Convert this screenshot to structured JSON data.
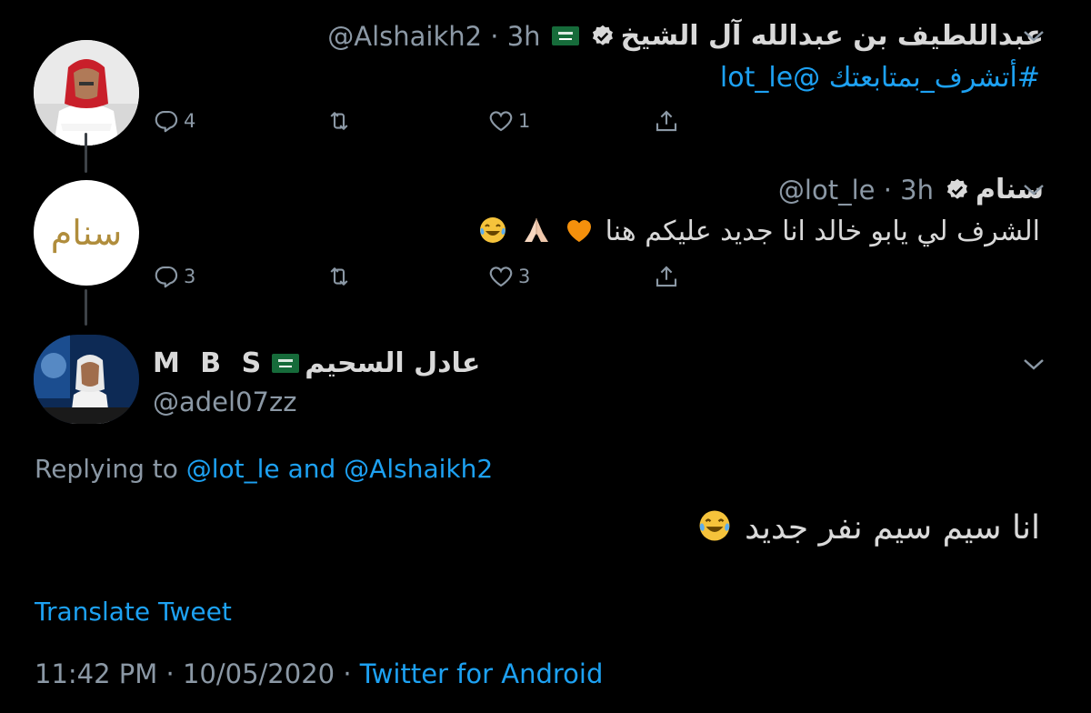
{
  "tweets": [
    {
      "name": "عبداللطيف بن عبدالله آل الشيخ",
      "handle": "@Alshaikh2",
      "time": "3h",
      "mention": "@lot_le",
      "hashtag": "#أتشرف_بمتابعتك",
      "replies": "4",
      "likes": "1"
    },
    {
      "name": "سنام",
      "avatar_text": "سنام",
      "handle": "@lot_le",
      "time": "3h",
      "text": "الشرف لي يابو خالد انا جديد عليكم هنا",
      "emojis": [
        "orange-heart",
        "folded-hands",
        "tears-of-joy"
      ],
      "replies": "3",
      "likes": "3"
    }
  ],
  "main_tweet": {
    "name": "عادل السحيم",
    "name_suffix": "M B S",
    "handle": "@adel07zz",
    "replying_prefix": "Replying to",
    "replying_to_1": "@lot_le",
    "replying_and": "and",
    "replying_to_2": "@Alshaikh2",
    "text": "انا سيم سيم نفر جديد",
    "emoji": "tears-of-joy",
    "translate": "Translate Tweet",
    "timestamp": "11:42 PM · 10/05/2020 ·",
    "source": "Twitter for Android"
  },
  "colors": {
    "background": "#000000",
    "text": "#d9d9d9",
    "secondary": "#8b98a5",
    "accent": "#1da1f2",
    "verified": "#d9d9d9"
  }
}
